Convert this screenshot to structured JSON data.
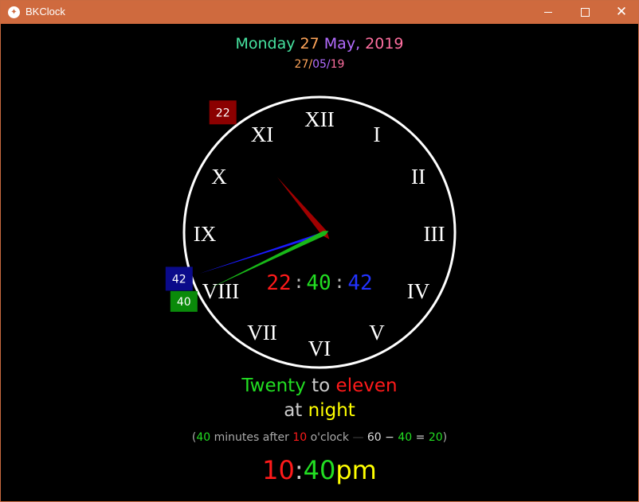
{
  "window": {
    "title": "BKClock",
    "icon": "bird-icon",
    "controls": {
      "minimize_icon": "minimize-icon",
      "maximize_icon": "maximize-icon",
      "close_label": "✕"
    }
  },
  "colors": {
    "titlebar": "#cf6a3e",
    "hour": "#ff1a1a",
    "minute": "#22dd22",
    "second": "#2233ff",
    "pink": "#ff6fa0",
    "orange": "#ffa55a",
    "purple": "#b36cff",
    "teal": "#46e3a0",
    "yellow": "#ffff00",
    "grey": "#bbbbbb"
  },
  "date": {
    "weekday": "Monday",
    "day": "27",
    "month": "May",
    "comma": ",",
    "year": "2019",
    "short_day": "27",
    "short_month": "05",
    "short_year": "19",
    "sep": "/"
  },
  "clock": {
    "numerals": [
      "XII",
      "I",
      "II",
      "III",
      "IIII",
      "IV",
      "V",
      "VI",
      "VII",
      "VIII",
      "IX",
      "X",
      "XI"
    ],
    "face_numerals": [
      "XII",
      "I",
      "II",
      "III",
      "IV",
      "V",
      "VI",
      "VII",
      "VIII",
      "IX",
      "X",
      "XI"
    ],
    "hour_badge": "22",
    "minute_badge": "40",
    "second_badge": "42",
    "digital": {
      "hours": "22",
      "minutes": "40",
      "seconds": "42",
      "sep": ":"
    },
    "time": {
      "hour": 22,
      "minute": 40,
      "second": 42
    }
  },
  "words": {
    "w1": "Twenty",
    "w2": "to",
    "w3": "eleven",
    "w4": "at",
    "w5": "night"
  },
  "explanation": {
    "open": "(",
    "minutes": "40",
    "text1": " minutes after ",
    "hour": "10",
    "text2": " o'clock ",
    "dash": "—",
    "calc_a": " 60 − ",
    "calc_b": "40",
    "calc_eq": " = ",
    "calc_c": "20",
    "close": ")"
  },
  "digital12": {
    "hour": "10",
    "sep": ":",
    "minute": "40",
    "ampm": "pm"
  }
}
